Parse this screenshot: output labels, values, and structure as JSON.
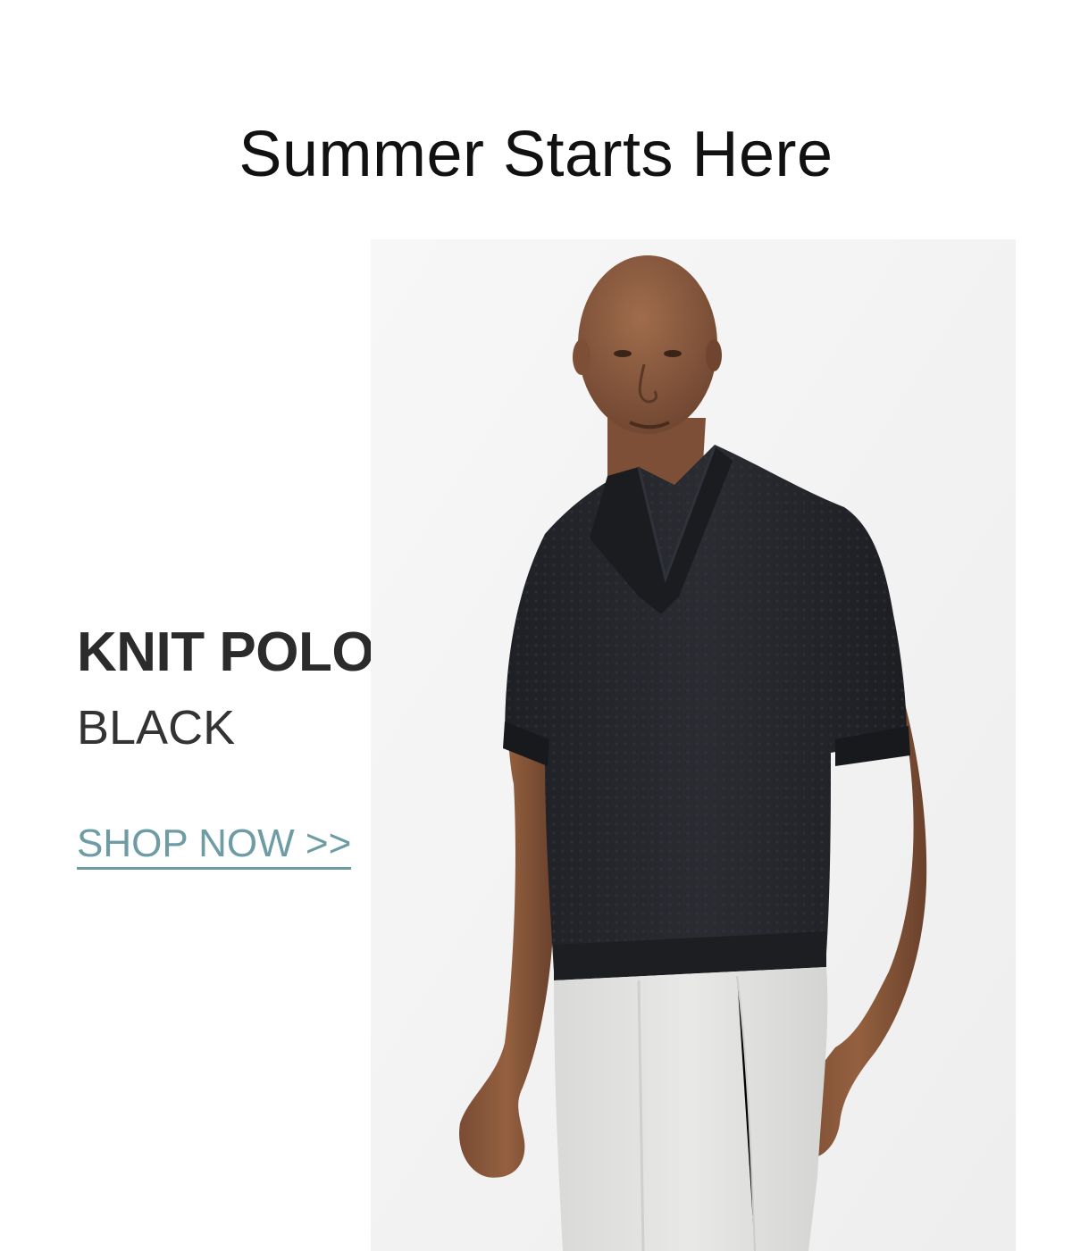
{
  "hero": {
    "headline": "Summer Starts Here"
  },
  "product": {
    "name": "KNIT POLO",
    "color": "BLACK",
    "cta_label": "SHOP NOW >>",
    "image_icon": "model-wearing-polo-photo"
  },
  "colors": {
    "accent": "#6e9ca4",
    "heading": "#111111",
    "photo_background": "#f5f5f5",
    "shirt": "#25272c",
    "pants": "#e4e4e2",
    "skin": "#8a5a3e"
  }
}
